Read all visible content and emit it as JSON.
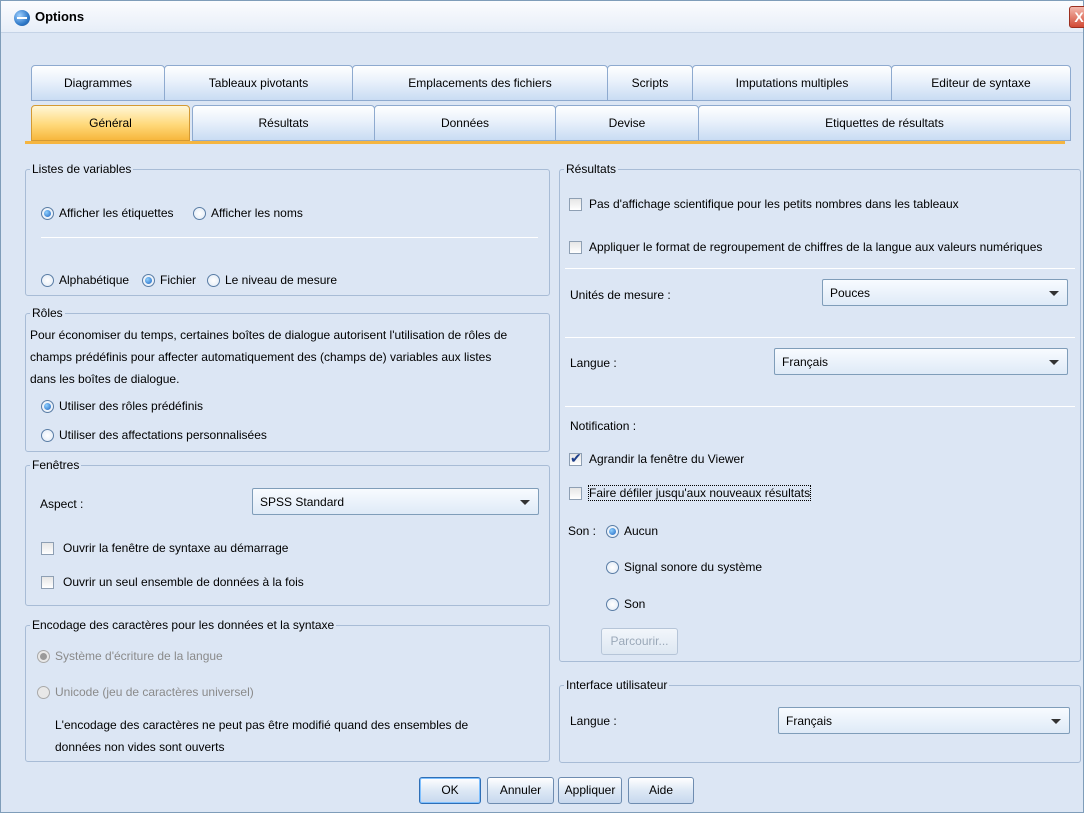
{
  "window": {
    "title": "Options",
    "close": "X"
  },
  "tabs_top": [
    "Diagrammes",
    "Tableaux pivotants",
    "Emplacements des fichiers",
    "Scripts",
    "Imputations multiples",
    "Editeur de syntaxe"
  ],
  "tabs_bottom": [
    "Général",
    "Résultats",
    "Données",
    "Devise",
    "Etiquettes de résultats"
  ],
  "active_tab": "Général",
  "variable_lists": {
    "legend": "Listes de variables",
    "display": [
      "Afficher les étiquettes",
      "Afficher les noms"
    ],
    "order": [
      "Alphabétique",
      "Fichier",
      "Le niveau de mesure"
    ]
  },
  "roles": {
    "legend": "Rôles",
    "description_lines": [
      "Pour économiser du temps, certaines boîtes de dialogue autorisent l'utilisation de rôles de",
      "champs prédéfinis pour affecter automatiquement des (champs de) variables aux listes",
      "dans les boîtes de dialogue."
    ],
    "options": [
      "Utiliser des rôles prédéfinis",
      "Utiliser des affectations personnalisées"
    ]
  },
  "windows": {
    "legend": "Fenêtres",
    "aspect_label": "Aspect :",
    "aspect_value": "SPSS Standard",
    "checkboxes": [
      "Ouvrir la fenêtre de syntaxe au démarrage",
      "Ouvrir un seul ensemble de données à la fois"
    ]
  },
  "encoding": {
    "legend": "Encodage des caractères pour les données et la syntaxe",
    "options": [
      "Système d'écriture de la langue",
      "Unicode (jeu de caractères universel)"
    ],
    "note_lines": [
      "L'encodage des caractères ne peut pas être modifié quand des ensembles de",
      "données non vides sont ouverts"
    ]
  },
  "results": {
    "legend": "Résultats",
    "checkboxes": [
      "Pas d'affichage scientifique pour les petits nombres dans les tableaux",
      "Appliquer le format de regroupement de chiffres de la langue aux valeurs numériques"
    ],
    "units_label": "Unités de mesure :",
    "units_value": "Pouces",
    "language_label": "Langue :",
    "language_value": "Français",
    "notification_label": "Notification :",
    "notify_checkboxes": [
      "Agrandir la fenêtre du Viewer",
      "Faire défiler jusqu'aux nouveaux résultats"
    ],
    "sound_label": "Son :",
    "sound_options": [
      "Aucun",
      "Signal sonore du système",
      "Son"
    ],
    "browse_label": "Parcourir..."
  },
  "ui": {
    "legend": "Interface utilisateur",
    "language_label": "Langue :",
    "language_value": "Français"
  },
  "buttons": [
    "OK",
    "Annuler",
    "Appliquer",
    "Aide"
  ]
}
